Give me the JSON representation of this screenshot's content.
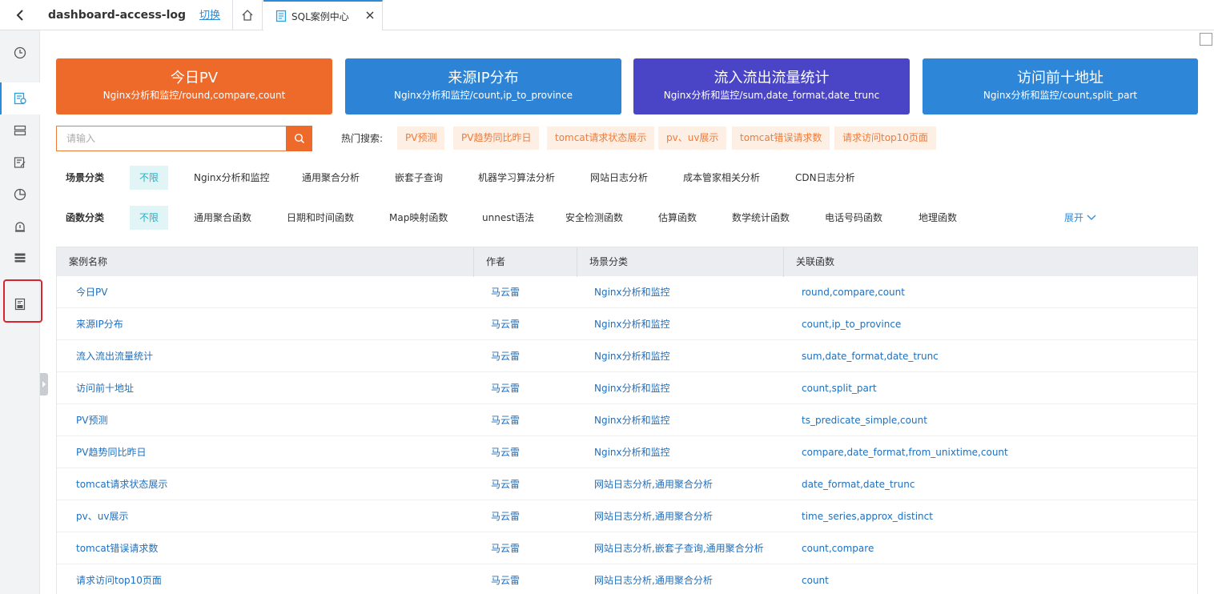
{
  "header": {
    "project_name": "dashboard-access-log",
    "switch_label": "切换",
    "tab_label": "SQL案例中心"
  },
  "cards": [
    {
      "title": "今日PV",
      "subtitle": "Nginx分析和监控/round,compare,count",
      "color": "#ee6a2a"
    },
    {
      "title": "来源IP分布",
      "subtitle": "Nginx分析和监控/count,ip_to_province",
      "color": "#2d84d6"
    },
    {
      "title": "流入流出流量统计",
      "subtitle": "Nginx分析和监控/sum,date_format,date_trunc",
      "color": "#4a44c6"
    },
    {
      "title": "访问前十地址",
      "subtitle": "Nginx分析和监控/count,split_part",
      "color": "#2e86d8"
    }
  ],
  "search": {
    "placeholder": "请输入",
    "hot_label": "热门搜索:",
    "hot_tags": [
      "PV预测",
      "PV趋势同比昨日",
      "tomcat请求状态展示",
      "pv、uv展示",
      "tomcat错误请求数",
      "请求访问top10页面"
    ]
  },
  "filters": {
    "scene": {
      "label": "场景分类",
      "options": [
        "不限",
        "Nginx分析和监控",
        "通用聚合分析",
        "嵌套子查询",
        "机器学习算法分析",
        "网站日志分析",
        "成本管家相关分析",
        "CDN日志分析"
      ]
    },
    "function": {
      "label": "函数分类",
      "options": [
        "不限",
        "通用聚合函数",
        "日期和时间函数",
        "Map映射函数",
        "unnest语法",
        "安全检测函数",
        "估算函数",
        "数学统计函数",
        "电话号码函数",
        "地理函数"
      ]
    },
    "expand_label": "展开"
  },
  "table": {
    "headers": [
      "案例名称",
      "作者",
      "场景分类",
      "关联函数"
    ],
    "rows": [
      {
        "name": "今日PV",
        "author": "马云雷",
        "scene": "Nginx分析和监控",
        "functions": "round,compare,count"
      },
      {
        "name": "来源IP分布",
        "author": "马云雷",
        "scene": "Nginx分析和监控",
        "functions": "count,ip_to_province"
      },
      {
        "name": "流入流出流量统计",
        "author": "马云雷",
        "scene": "Nginx分析和监控",
        "functions": "sum,date_format,date_trunc"
      },
      {
        "name": "访问前十地址",
        "author": "马云雷",
        "scene": "Nginx分析和监控",
        "functions": "count,split_part"
      },
      {
        "name": "PV预测",
        "author": "马云雷",
        "scene": "Nginx分析和监控",
        "functions": "ts_predicate_simple,count"
      },
      {
        "name": "PV趋势同比昨日",
        "author": "马云雷",
        "scene": "Nginx分析和监控",
        "functions": "compare,date_format,from_unixtime,count"
      },
      {
        "name": "tomcat请求状态展示",
        "author": "马云雷",
        "scene": "网站日志分析,通用聚合分析",
        "functions": "date_format,date_trunc"
      },
      {
        "name": "pv、uv展示",
        "author": "马云雷",
        "scene": "网站日志分析,通用聚合分析",
        "functions": "time_series,approx_distinct"
      },
      {
        "name": "tomcat错误请求数",
        "author": "马云雷",
        "scene": "网站日志分析,嵌套子查询,通用聚合分析",
        "functions": "count,compare"
      },
      {
        "name": "请求访问top10页面",
        "author": "马云雷",
        "scene": "网站日志分析,通用聚合分析",
        "functions": "count"
      }
    ]
  },
  "sidebar": {
    "icons": [
      "clock-icon",
      "log-search-icon",
      "logstore-icon",
      "query-edit-icon",
      "dashboard-chart-icon",
      "alert-icon",
      "list-icon",
      "sql-case-icon"
    ]
  }
}
